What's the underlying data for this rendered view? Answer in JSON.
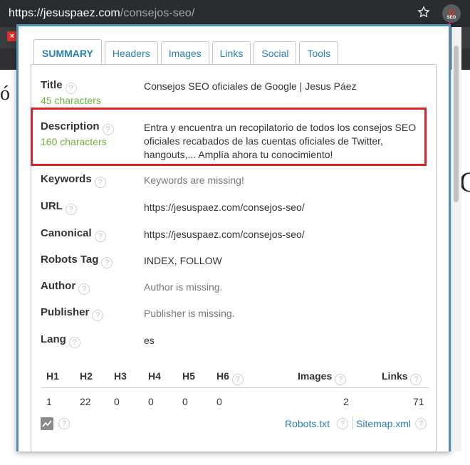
{
  "browser": {
    "url_host": "https://jesuspaez.com",
    "url_path": "/consejos-seo/",
    "extension_badge": "S",
    "extension_sub": "SEO"
  },
  "tabs": [
    {
      "label": "SUMMARY",
      "active": true
    },
    {
      "label": "Headers",
      "active": false
    },
    {
      "label": "Images",
      "active": false
    },
    {
      "label": "Links",
      "active": false
    },
    {
      "label": "Social",
      "active": false
    },
    {
      "label": "Tools",
      "active": false
    }
  ],
  "summary": {
    "title": {
      "label": "Title",
      "count": "45 characters",
      "value": "Consejos SEO oficiales de Google | Jesus Páez"
    },
    "description": {
      "label": "Description",
      "count": "160 characters",
      "value": "Entra y encuentra un recopilatorio de todos los consejos SEO oficiales recabados de las cuentas oficiales de Twitter, hangouts,... Amplía ahora tu conocimiento!"
    },
    "keywords": {
      "label": "Keywords",
      "value": "Keywords are missing!"
    },
    "url": {
      "label": "URL",
      "value": "https://jesuspaez.com/consejos-seo/"
    },
    "canonical": {
      "label": "Canonical",
      "value": "https://jesuspaez.com/consejos-seo/"
    },
    "robots": {
      "label": "Robots Tag",
      "value": "INDEX, FOLLOW"
    },
    "author": {
      "label": "Author",
      "value": "Author is missing."
    },
    "publisher": {
      "label": "Publisher",
      "value": "Publisher is missing."
    },
    "lang": {
      "label": "Lang",
      "value": "es"
    }
  },
  "counts_table": {
    "headers": [
      "H1",
      "H2",
      "H3",
      "H4",
      "H5",
      "H6",
      "Images",
      "Links"
    ],
    "values": [
      "1",
      "22",
      "0",
      "0",
      "0",
      "0",
      "2",
      "71"
    ]
  },
  "footer": {
    "robots_link": "Robots.txt",
    "sitemap_link": "Sitemap.xml"
  },
  "help_glyph": "?",
  "colors": {
    "accent": "#2a7fb5",
    "count_green": "#6db33f",
    "highlight_red": "#d9232a",
    "popup_border": "#4f8fb8"
  }
}
